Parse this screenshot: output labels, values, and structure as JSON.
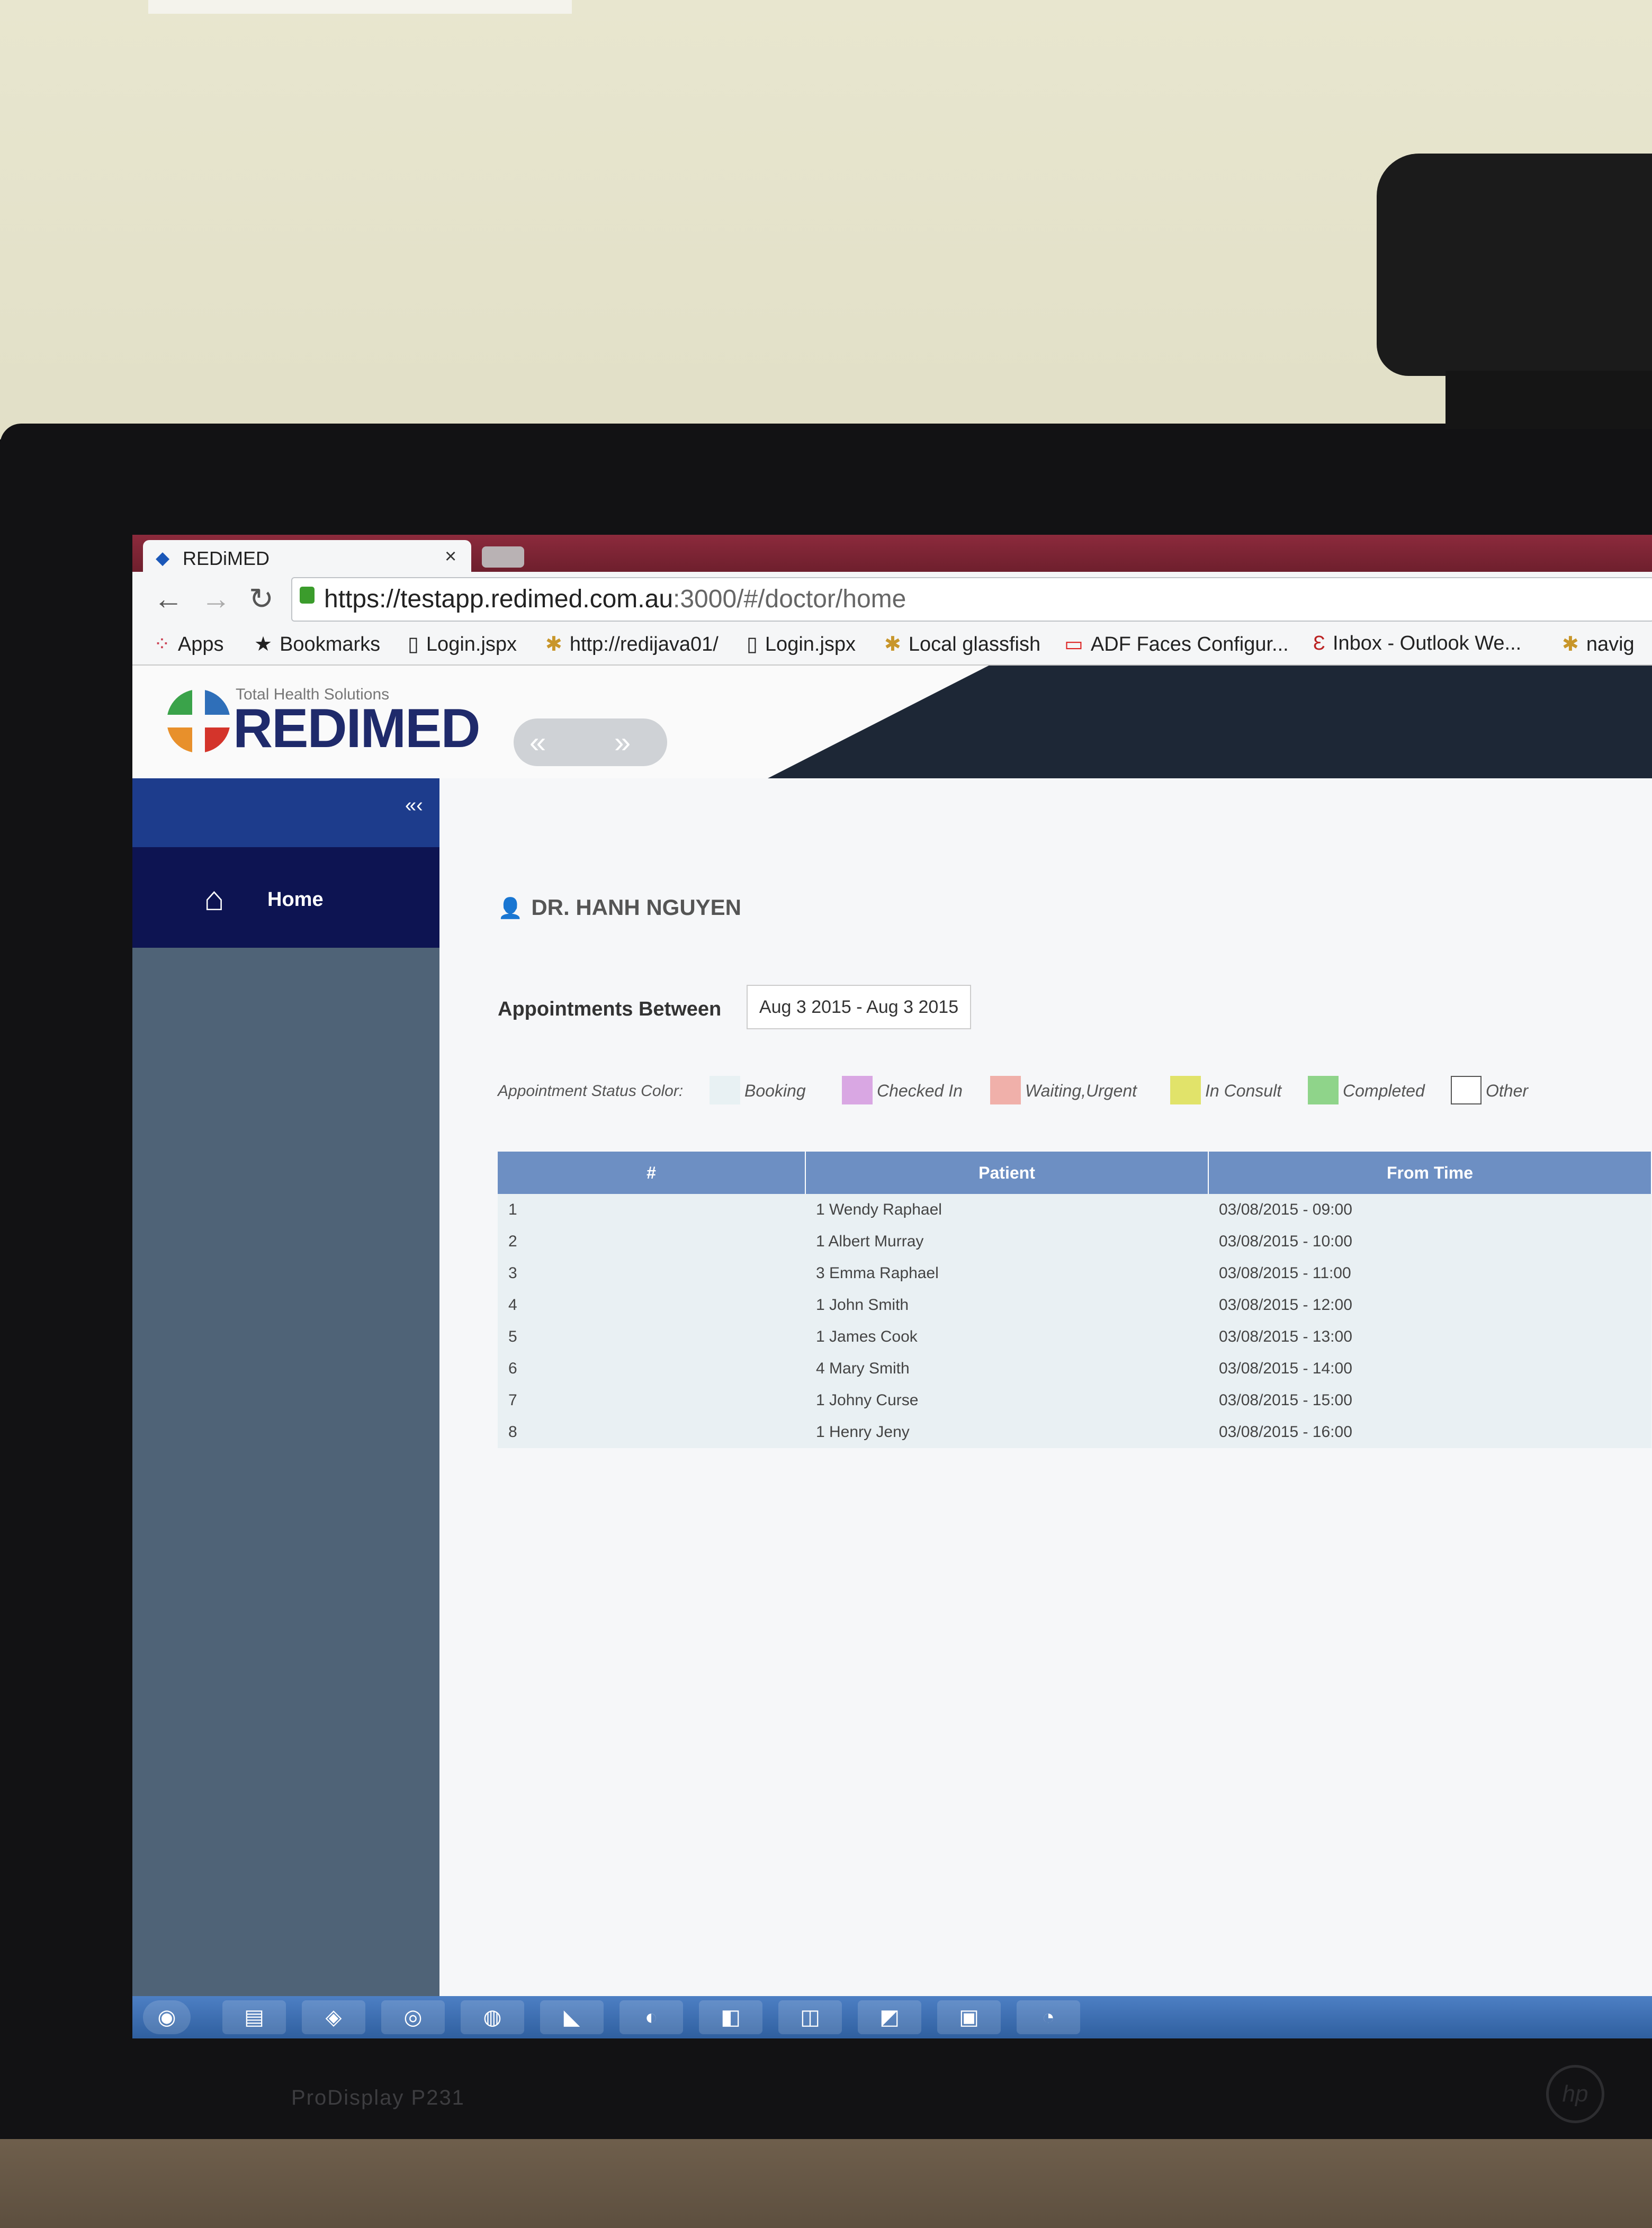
{
  "browser": {
    "tab_title": "REDiMED",
    "tab_close": "×",
    "url_host": "https://testapp.redimed.com.au",
    "url_path": ":3000/#/doctor/home",
    "bookmarks": [
      {
        "icon": "apps-grid-icon",
        "label": "Apps"
      },
      {
        "icon": "star-icon",
        "label": "Bookmarks"
      },
      {
        "icon": "page-icon",
        "label": "Login.jspx"
      },
      {
        "icon": "runner-icon",
        "label": "http://redijava01/"
      },
      {
        "icon": "page-icon",
        "label": "Login.jspx"
      },
      {
        "icon": "runner-icon",
        "label": "Local glassfish"
      },
      {
        "icon": "oracle-icon",
        "label": "ADF Faces Configur..."
      },
      {
        "icon": "exchange-icon",
        "label": "Inbox - Outlook We..."
      },
      {
        "icon": "runner-icon",
        "label": "navig"
      }
    ]
  },
  "header": {
    "tagline": "Total Health Solutions",
    "logo_word": "REDIMED",
    "pill_left": "«",
    "pill_right": "»"
  },
  "sidebar": {
    "collapse_label": "«‹",
    "items": [
      {
        "icon": "home-icon",
        "label": "Home"
      }
    ]
  },
  "main": {
    "doctor_name": "DR. HANH NGUYEN",
    "appointments_label": "Appointments Between",
    "date_range": "Aug 3 2015 - Aug 3 2015",
    "status_title": "Appointment Status Color:",
    "legend": [
      {
        "label": "Booking",
        "color": "#e8f1f3"
      },
      {
        "label": "Checked In",
        "color": "#d9a7e3"
      },
      {
        "label": "Waiting,Urgent",
        "color": "#f0b0aa"
      },
      {
        "label": "In Consult",
        "color": "#e1e36a"
      },
      {
        "label": "Completed",
        "color": "#8fd48a"
      },
      {
        "label": "Other",
        "color": "#ffffff"
      }
    ],
    "table": {
      "headers": [
        "#",
        "Patient",
        "From Time"
      ],
      "rows": [
        {
          "num": "1",
          "patient": "1 Wendy Raphael",
          "from": "03/08/2015 - 09:00"
        },
        {
          "num": "2",
          "patient": "1 Albert Murray",
          "from": "03/08/2015 - 10:00"
        },
        {
          "num": "3",
          "patient": "3 Emma Raphael",
          "from": "03/08/2015 - 11:00"
        },
        {
          "num": "4",
          "patient": "1 John Smith",
          "from": "03/08/2015 - 12:00"
        },
        {
          "num": "5",
          "patient": "1 James Cook",
          "from": "03/08/2015 - 13:00"
        },
        {
          "num": "6",
          "patient": "4 Mary Smith",
          "from": "03/08/2015 - 14:00"
        },
        {
          "num": "7",
          "patient": "1 Johny Curse",
          "from": "03/08/2015 - 15:00"
        },
        {
          "num": "8",
          "patient": "1 Henry Jeny",
          "from": "03/08/2015 - 16:00"
        }
      ]
    }
  },
  "monitor": {
    "brand": "ProDisplay P231",
    "logo": "hp"
  }
}
